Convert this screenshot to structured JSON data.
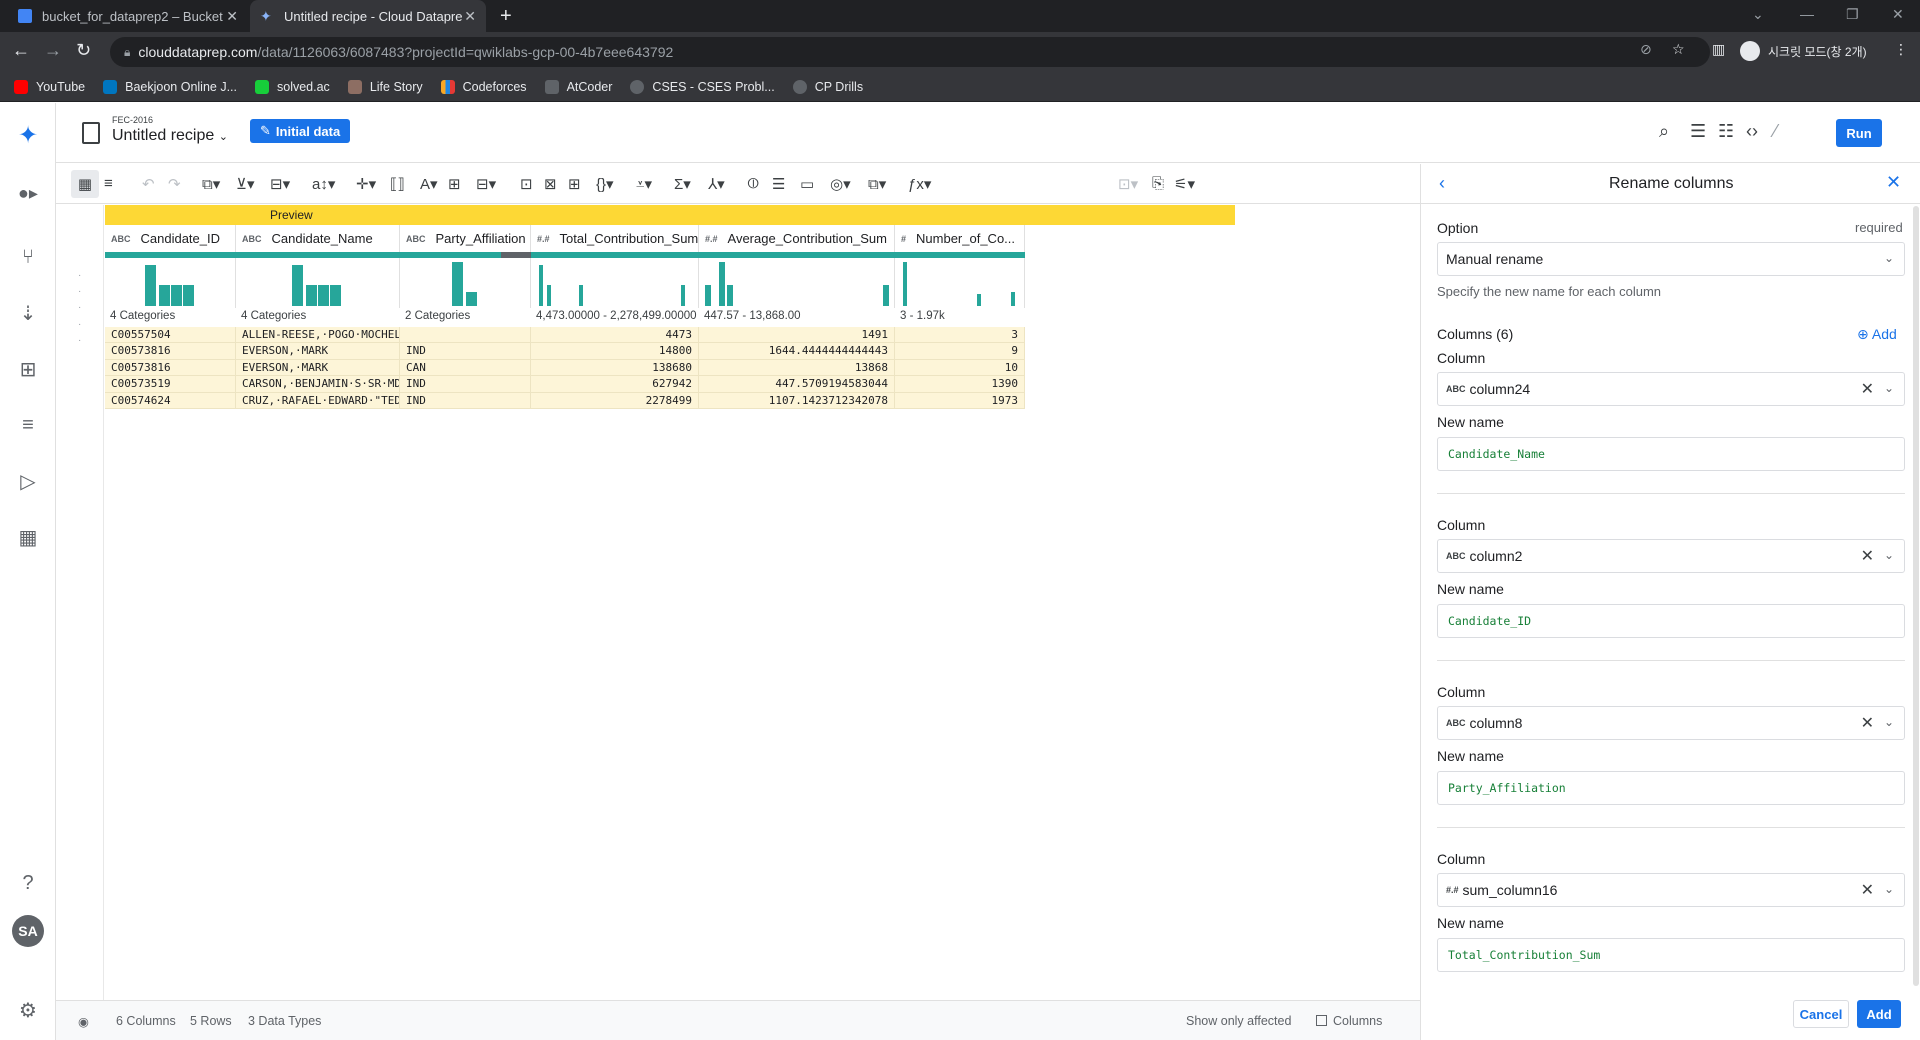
{
  "browser": {
    "tabs": [
      {
        "title": "bucket_for_dataprep2 – Bucket"
      },
      {
        "title": "Untitled recipe - Cloud Datapre"
      }
    ],
    "url_host": "clouddataprep.com",
    "url_path": "/data/1126063/6087483?projectId=qwiklabs-gcp-00-4b7eee643792",
    "profile_label": "시크릿 모드(창 2개)",
    "bookmarks": [
      "YouTube",
      "Baekjoon Online J...",
      "solved.ac",
      "Life Story",
      "Codeforces",
      "AtCoder",
      "CSES - CSES Probl...",
      "CP Drills"
    ]
  },
  "header": {
    "dataset": "FEC-2016",
    "recipe_title": "Untitled recipe",
    "initial_data_label": "Initial data",
    "run_label": "Run"
  },
  "grid": {
    "preview_label": "Preview",
    "columns": [
      {
        "type": "ABC",
        "name": "Candidate_ID",
        "summary": "4 Categories"
      },
      {
        "type": "ABC",
        "name": "Candidate_Name",
        "summary": "4 Categories"
      },
      {
        "type": "ABC",
        "name": "Party_Affiliation",
        "summary": "2 Categories"
      },
      {
        "type": "#.#",
        "name": "Total_Contribution_Sum",
        "summary": "4,473.00000 - 2,278,499.00000"
      },
      {
        "type": "#.#",
        "name": "Average_Contribution_Sum",
        "summary": "447.57 - 13,868.00"
      },
      {
        "type": "#",
        "name": "Number_of_Co...",
        "summary": "3 - 1.97k"
      }
    ],
    "rows": [
      [
        "C00557504",
        "ALLEN-REESE,·POGO·MOCHELLO",
        "",
        "4473",
        "1491",
        "3"
      ],
      [
        "C00573816",
        "EVERSON,·MARK",
        "IND",
        "14800",
        "1644.4444444444443",
        "9"
      ],
      [
        "C00573816",
        "EVERSON,·MARK",
        "CAN",
        "138680",
        "13868",
        "10"
      ],
      [
        "C00573519",
        "CARSON,·BENJAMIN·S·SR·MD",
        "IND",
        "627942",
        "447.5709194583044",
        "1390"
      ],
      [
        "C00574624",
        "CRUZ,·RAFAEL·EDWARD·\"TED\"",
        "IND",
        "2278499",
        "1107.1423712342078",
        "1973"
      ]
    ]
  },
  "status": {
    "columns": "6 Columns",
    "rows": "5 Rows",
    "types": "3 Data Types",
    "show_affected": "Show only affected",
    "columns_check": "Columns"
  },
  "panel": {
    "title": "Rename columns",
    "option_label": "Option",
    "required_label": "required",
    "option_value": "Manual rename",
    "option_help": "Specify the new name for each column",
    "columns_count": "Columns (6)",
    "add_label": "Add",
    "column_label": "Column",
    "newname_label": "New name",
    "mappings": [
      {
        "type": "ABC",
        "column": "column24",
        "new_name": "Candidate_Name"
      },
      {
        "type": "ABC",
        "column": "column2",
        "new_name": "Candidate_ID"
      },
      {
        "type": "ABC",
        "column": "column8",
        "new_name": "Party_Affiliation"
      },
      {
        "type": "#.#",
        "column": "sum_column16",
        "new_name": "Total_Contribution_Sum"
      }
    ],
    "cancel_label": "Cancel",
    "add_button_label": "Add"
  },
  "colors": {
    "accent": "#1a73e8",
    "preview": "#fdd835",
    "quality_ok": "#26a69a",
    "cell_bg": "#fdf5d8"
  },
  "histograms": [
    [
      0.9,
      0.45,
      0.45,
      0.45
    ],
    [
      0.9,
      0.45,
      0.45,
      0.45
    ],
    [
      0.95,
      0.3
    ],
    [
      0.9,
      0.45,
      0.45,
      0.45
    ],
    [
      0.45,
      0.95,
      0.45,
      0.45
    ],
    [
      0.95,
      0.25,
      0.3
    ]
  ]
}
